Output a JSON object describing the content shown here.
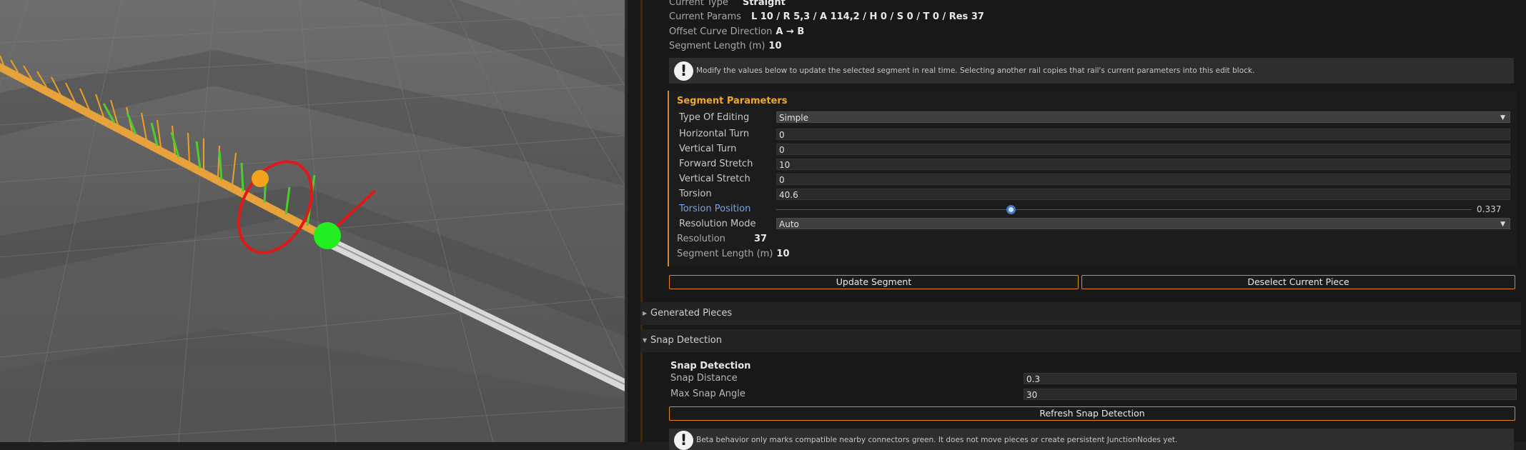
{
  "rail_info": {
    "current_type_label": "Current Type",
    "current_type_value": "Straight",
    "current_params_label": "Current Params",
    "current_params_value": "L 10 / R 5,3 / A 114,2 / H 0 / S 0 / T 0 / Res 37",
    "offset_direction_label": "Offset Curve Direction",
    "offset_direction_value": "A → B",
    "segment_length_label": "Segment Length (m)",
    "segment_length_value": "10"
  },
  "edit_info": {
    "icon": "exclamation-icon",
    "text": "Modify the values below to update the selected segment in real time. Selecting another rail copies that rail's current parameters into this edit block."
  },
  "segment_parameters": {
    "title": "Segment Parameters",
    "type_of_editing_label": "Type Of Editing",
    "type_of_editing_value": "Simple",
    "horizontal_turn_label": "Horizontal Turn",
    "horizontal_turn_value": "0",
    "vertical_turn_label": "Vertical Turn",
    "vertical_turn_value": "0",
    "forward_stretch_label": "Forward Stretch",
    "forward_stretch_value": "10",
    "vertical_stretch_label": "Vertical Stretch",
    "vertical_stretch_value": "0",
    "torsion_label": "Torsion",
    "torsion_value": "40.6",
    "torsion_position_label": "Torsion Position",
    "torsion_position_value": "0.337",
    "resolution_mode_label": "Resolution Mode",
    "resolution_mode_value": "Auto",
    "resolution_label": "Resolution",
    "resolution_value": "37",
    "segment_length_label": "Segment Length (m)",
    "segment_length_value": "10"
  },
  "actions": {
    "update_segment": "Update Segment",
    "deselect_current_piece": "Deselect Current Piece"
  },
  "generated_pieces": {
    "title": "Generated Pieces"
  },
  "snap_detection": {
    "foldout_title": "Snap Detection",
    "section_title": "Snap Detection",
    "snap_distance_label": "Snap Distance",
    "snap_distance_value": "0.3",
    "max_snap_angle_label": "Max Snap Angle",
    "max_snap_angle_value": "30",
    "refresh_button": "Refresh Snap Detection",
    "beta_info_text": "Beta behavior only marks compatible nearby connectors green. It does not move pieces or create persistent JunctionNodes yet."
  },
  "colors": {
    "accent_orange": "#f0a828",
    "button_border": "#e08a1e",
    "link_blue": "#6ea7e6",
    "gizmo_red": "#e01818",
    "gizmo_green": "#22ee22",
    "gizmo_yellow": "#f2a51c"
  }
}
